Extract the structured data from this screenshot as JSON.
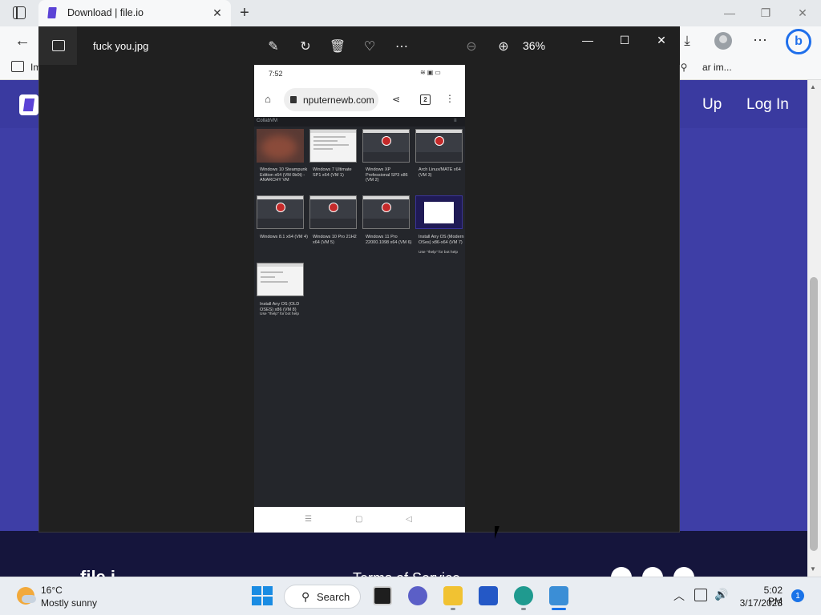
{
  "browser": {
    "tab_title": "Download | file.io",
    "tab_close": "✕",
    "new_tab": "+",
    "fav_first": "Im",
    "fav_popup_text": "ar im...",
    "icons": [
      "tab-actions-icon",
      "back-arrow-icon",
      "download-icon",
      "profile-avatar-icon",
      "more-icon",
      "bing-chat-icon",
      "favorites-folder-icon",
      "pin-icon"
    ],
    "window_controls": {
      "minimize": "—",
      "restore": "❐",
      "close": "✕"
    }
  },
  "page": {
    "signup": "Up",
    "login": "Log In",
    "footer_logo": "file.i",
    "footer_terms": "Terms of Service",
    "colors": {
      "header": "#3a3aa0",
      "body": "#3e3ea6",
      "footer": "#15153c"
    }
  },
  "photos": {
    "filename": "fuck you.jpg",
    "zoom": "36%",
    "icons": [
      "edit-image-icon",
      "rotate-icon",
      "delete-icon",
      "favorite-heart-icon",
      "more-options-icon",
      "zoom-out-icon",
      "zoom-in-icon"
    ],
    "window_controls": {
      "minimize": "—",
      "maximize": "☐",
      "close": "✕"
    }
  },
  "phone": {
    "time": "7:52",
    "url": "nputernewb.com",
    "tab_count": "2",
    "site_name": "CollabVM",
    "site_menu": "≡",
    "vms": [
      {
        "label": "Windows 10 Steampunk Edition x64 (VM 0b0t) - ANARCHY VM",
        "thumb": "blur"
      },
      {
        "label": "Windows 7 Ultimate SP1 x64 (VM 1)",
        "thumb": "light"
      },
      {
        "label": "Windows XP Professional SP3 x86 (VM 2)",
        "thumb": "logo"
      },
      {
        "label": "Arch Linux/MATE x64 (VM 3)",
        "thumb": "logo"
      },
      {
        "label": "Windows 8.1 x64 (VM 4)",
        "thumb": "logo"
      },
      {
        "label": "Windows 10 Pro 21H2 x64 (VM 5)",
        "thumb": "logo"
      },
      {
        "label": "Windows 11 Pro 22000.1098 x64 (VM 6)",
        "thumb": "logo"
      },
      {
        "label": "Install Any OS (Modern OSes) x86-x64 (VM 7)",
        "note": "Use \"!help\" for bot help",
        "thumb": "purple"
      },
      {
        "label": "Install Any OS (OLD OSES) x86 (VM 8)",
        "note": "Use \"!help\" for bot help",
        "thumb": "light"
      }
    ],
    "nav_keys": {
      "recents": "☰",
      "home": "▢",
      "back": "◁"
    }
  },
  "taskbar": {
    "weather_temp": "16°C",
    "weather_cond": "Mostly sunny",
    "search_label": "Search",
    "apps": [
      "terminal",
      "teams-meet",
      "file-explorer",
      "microsoft-store",
      "edge",
      "photos"
    ],
    "clock_time": "5:02 PM",
    "clock_date": "3/17/2023",
    "notification_count": "1"
  }
}
